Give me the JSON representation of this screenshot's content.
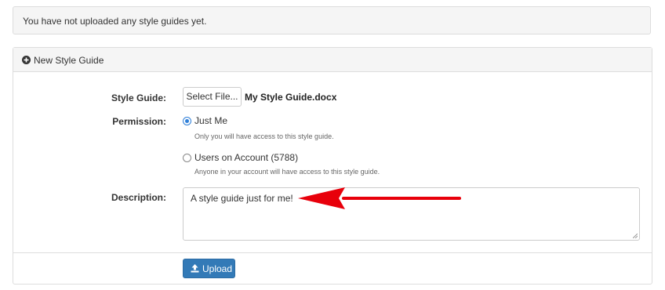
{
  "notice": {
    "text": "You have not uploaded any style guides yet."
  },
  "panel": {
    "heading": "New Style Guide",
    "heading_icon": "plus-circle-icon"
  },
  "form": {
    "style_guide": {
      "label": "Style Guide:",
      "button_label": "Select File...",
      "file_name": "My Style Guide.docx"
    },
    "permission": {
      "label": "Permission:",
      "options": [
        {
          "label": "Just Me",
          "help": "Only you will have access to this style guide.",
          "selected": true
        },
        {
          "label": "Users on Account (5788)",
          "help": "Anyone in your account will have access to this style guide.",
          "selected": false
        }
      ]
    },
    "description": {
      "label": "Description:",
      "value": "A style guide just for me!"
    },
    "upload": {
      "label": "Upload",
      "icon": "upload-icon"
    }
  },
  "annotation": {
    "arrow_color": "#e8000b"
  },
  "colors": {
    "primary": "#337ab7",
    "radio_accent": "#2f7fd8",
    "panel_bg": "#f5f5f5",
    "border": "#dddddd"
  }
}
